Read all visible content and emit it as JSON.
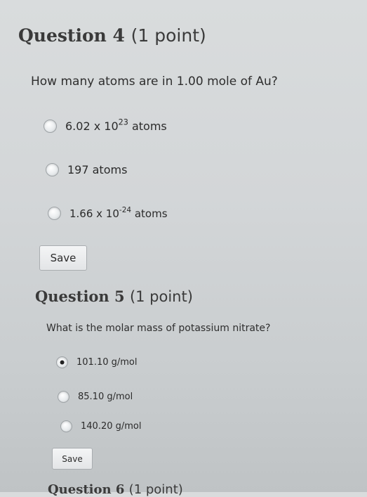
{
  "questions": [
    {
      "title": "Question 4",
      "points": "(1 point)",
      "text": "How many atoms are in 1.00 mole of Au?",
      "options": [
        {
          "base": "6.02 x 10",
          "exp": "23",
          "suffix": " atoms",
          "selected": false
        },
        {
          "base": "197 atoms",
          "exp": "",
          "suffix": "",
          "selected": false
        },
        {
          "base": "1.66 x 10",
          "exp": "-24",
          "suffix": " atoms",
          "selected": false
        }
      ],
      "save_label": "Save"
    },
    {
      "title": "Question 5",
      "points": "(1 point)",
      "text": "What is the molar mass of potassium nitrate?",
      "options": [
        {
          "base": "101.10 g/mol",
          "exp": "",
          "suffix": "",
          "selected": true
        },
        {
          "base": "85.10 g/mol",
          "exp": "",
          "suffix": "",
          "selected": false
        },
        {
          "base": "140.20 g/mol",
          "exp": "",
          "suffix": "",
          "selected": false
        }
      ],
      "save_label": "Save"
    },
    {
      "title": "Question 6",
      "points": "(1 point)"
    }
  ],
  "colors": {
    "background": "#d6d9db",
    "text": "#2b2b2b",
    "selected_dot": "#222222"
  }
}
